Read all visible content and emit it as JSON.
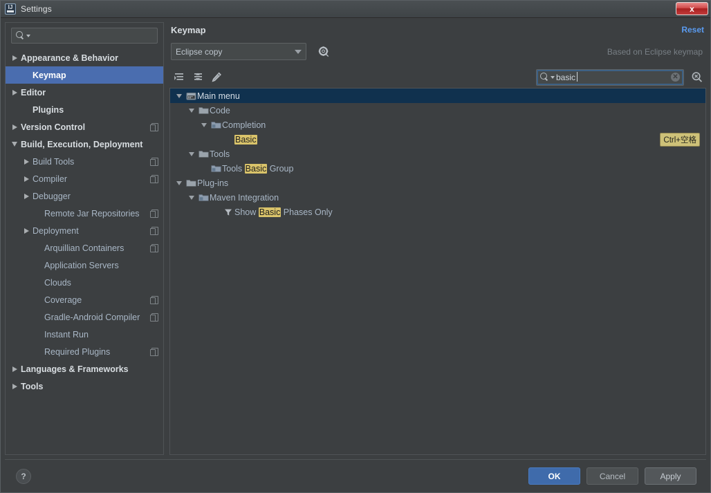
{
  "window": {
    "title": "Settings",
    "app_icon": "intellij-idea-icon",
    "close_label": "x"
  },
  "sidebar": {
    "search": {
      "placeholder": "",
      "value": "",
      "icon": "search-icon"
    },
    "items": [
      {
        "label": "Appearance & Behavior",
        "level": 0,
        "arrow": "right",
        "bold": true,
        "badge": false,
        "selected": false
      },
      {
        "label": "Keymap",
        "level": 1,
        "arrow": "none",
        "bold": true,
        "badge": false,
        "selected": true
      },
      {
        "label": "Editor",
        "level": 0,
        "arrow": "right",
        "bold": true,
        "badge": false,
        "selected": false
      },
      {
        "label": "Plugins",
        "level": 1,
        "arrow": "none",
        "bold": true,
        "badge": false,
        "selected": false
      },
      {
        "label": "Version Control",
        "level": 0,
        "arrow": "right",
        "bold": true,
        "badge": true,
        "selected": false
      },
      {
        "label": "Build, Execution, Deployment",
        "level": 0,
        "arrow": "down",
        "bold": true,
        "badge": false,
        "selected": false
      },
      {
        "label": "Build Tools",
        "level": 1,
        "arrow": "right",
        "bold": false,
        "badge": true,
        "selected": false
      },
      {
        "label": "Compiler",
        "level": 1,
        "arrow": "right",
        "bold": false,
        "badge": true,
        "selected": false
      },
      {
        "label": "Debugger",
        "level": 1,
        "arrow": "right",
        "bold": false,
        "badge": false,
        "selected": false
      },
      {
        "label": "Remote Jar Repositories",
        "level": 2,
        "arrow": "none",
        "bold": false,
        "badge": true,
        "selected": false
      },
      {
        "label": "Deployment",
        "level": 1,
        "arrow": "right",
        "bold": false,
        "badge": true,
        "selected": false
      },
      {
        "label": "Arquillian Containers",
        "level": 2,
        "arrow": "none",
        "bold": false,
        "badge": true,
        "selected": false
      },
      {
        "label": "Application Servers",
        "level": 2,
        "arrow": "none",
        "bold": false,
        "badge": false,
        "selected": false
      },
      {
        "label": "Clouds",
        "level": 2,
        "arrow": "none",
        "bold": false,
        "badge": false,
        "selected": false
      },
      {
        "label": "Coverage",
        "level": 2,
        "arrow": "none",
        "bold": false,
        "badge": true,
        "selected": false
      },
      {
        "label": "Gradle-Android Compiler",
        "level": 2,
        "arrow": "none",
        "bold": false,
        "badge": true,
        "selected": false
      },
      {
        "label": "Instant Run",
        "level": 2,
        "arrow": "none",
        "bold": false,
        "badge": false,
        "selected": false
      },
      {
        "label": "Required Plugins",
        "level": 2,
        "arrow": "none",
        "bold": false,
        "badge": true,
        "selected": false
      },
      {
        "label": "Languages & Frameworks",
        "level": 0,
        "arrow": "right",
        "bold": true,
        "badge": false,
        "selected": false
      },
      {
        "label": "Tools",
        "level": 0,
        "arrow": "right",
        "bold": true,
        "badge": false,
        "selected": false
      }
    ]
  },
  "pane": {
    "title": "Keymap",
    "reset_label": "Reset",
    "keymap_selected": "Eclipse copy",
    "based_on": "Based on Eclipse keymap",
    "gear_icon": "gear-icon"
  },
  "toolbar": {
    "buttons": [
      {
        "name": "expand-all-icon"
      },
      {
        "name": "collapse-all-icon"
      },
      {
        "name": "edit-shortcut-icon"
      }
    ],
    "search": {
      "value": "basic",
      "placeholder": "",
      "icon": "search-icon",
      "clear_label": "✕"
    },
    "find_by_shortcut_icon": "find-by-shortcut-icon"
  },
  "action_tree": {
    "rows": [
      {
        "label_parts": [
          {
            "t": "Main menu",
            "hl": false
          }
        ],
        "indent": 0,
        "arrow": "down",
        "icon": "menu-bar-icon",
        "selected": true,
        "shortcut": ""
      },
      {
        "label_parts": [
          {
            "t": "Code",
            "hl": false
          }
        ],
        "indent": 1,
        "arrow": "down",
        "icon": "folder-icon",
        "selected": false,
        "shortcut": ""
      },
      {
        "label_parts": [
          {
            "t": "Completion",
            "hl": false
          }
        ],
        "indent": 2,
        "arrow": "down",
        "icon": "folder-blue-icon",
        "selected": false,
        "shortcut": ""
      },
      {
        "label_parts": [
          {
            "t": "Basic",
            "hl": true
          }
        ],
        "indent": 4,
        "arrow": "none",
        "icon": "none",
        "selected": false,
        "shortcut": "Ctrl+空格"
      },
      {
        "label_parts": [
          {
            "t": "Tools",
            "hl": false
          }
        ],
        "indent": 1,
        "arrow": "down",
        "icon": "folder-icon",
        "selected": false,
        "shortcut": ""
      },
      {
        "label_parts": [
          {
            "t": "Tools ",
            "hl": false
          },
          {
            "t": "Basic",
            "hl": true
          },
          {
            "t": " Group",
            "hl": false
          }
        ],
        "indent": 2,
        "arrow": "none",
        "icon": "folder-blue-icon",
        "selected": false,
        "shortcut": ""
      },
      {
        "label_parts": [
          {
            "t": "Plug-ins",
            "hl": false
          }
        ],
        "indent": 0,
        "arrow": "down",
        "icon": "folder-icon",
        "selected": false,
        "shortcut": ""
      },
      {
        "label_parts": [
          {
            "t": "Maven Integration",
            "hl": false
          }
        ],
        "indent": 1,
        "arrow": "down",
        "icon": "folder-blue-icon",
        "selected": false,
        "shortcut": ""
      },
      {
        "label_parts": [
          {
            "t": "Show ",
            "hl": false
          },
          {
            "t": "Basic",
            "hl": true
          },
          {
            "t": " Phases Only",
            "hl": false
          }
        ],
        "indent": 3,
        "arrow": "none",
        "icon": "filter-icon",
        "selected": false,
        "shortcut": ""
      }
    ]
  },
  "footer": {
    "help_label": "?",
    "ok_label": "OK",
    "cancel_label": "Cancel",
    "apply_label": "Apply"
  },
  "colors": {
    "window_bg": "#3c3f41",
    "sidebar_selection": "#4a6daf",
    "tree_selection": "#10314e",
    "accent_link": "#5a9bf0",
    "highlight": "#d9c36a",
    "shortcut_badge": "#cdc178",
    "primary_button": "#3f6bab",
    "close_button": "#c23b3b",
    "text": "#a9b7c6"
  }
}
